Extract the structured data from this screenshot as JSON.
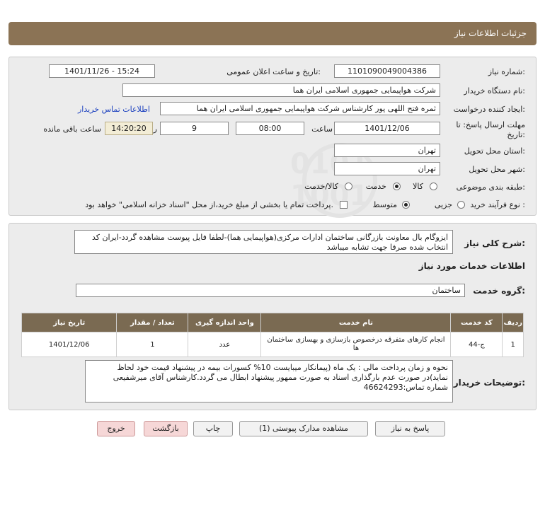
{
  "header": {
    "title": "جزئیات اطلاعات نیاز"
  },
  "form": {
    "need_number_label": "شماره نیاز:",
    "need_number": "1101090049004386",
    "announce_label": "تاریخ و ساعت اعلان عمومی:",
    "announce_value": "1401/11/26 - 15:24",
    "buyer_org_label": "نام دستگاه خریدار:",
    "buyer_org": "شرکت هواپیمایی جمهوری اسلامی ایران هما",
    "requester_label": "ایجاد کننده درخواست:",
    "requester": "ثمره فتح اللهی پور کارشناس شرکت هواپیمایی جمهوری اسلامی ایران هما",
    "contact_link": "اطلاعات تماس خریدار",
    "deadline_label_1": "مهلت ارسال پاسخ: تا",
    "deadline_label_2": "تاریخ:",
    "deadline_date": "1401/12/06",
    "time_label": "ساعت",
    "deadline_time": "08:00",
    "days_value": "9",
    "days_label": "روز و",
    "remaining_time": "14:20:20",
    "remaining_label": "ساعت باقی مانده",
    "province_label": "استان محل تحویل:",
    "province": "تهران",
    "city_label": "شهر محل تحویل:",
    "city": "تهران",
    "category_label": "طبقه بندی موضوعی:",
    "category_options": [
      "کالا",
      "خدمت",
      "کالا/خدمت"
    ],
    "category_selected": "خدمت",
    "process_label": "نوع فرآیند خرید :",
    "process_options": [
      "جزیی",
      "متوسط"
    ],
    "process_selected": "متوسط",
    "payment_note": "پرداخت تمام یا بخشی از مبلغ خرید،از محل \"اسناد خزانه اسلامی\" خواهد بود."
  },
  "description": {
    "label": "شرح کلی نیاز:",
    "text": "ایزوگام بال معاونت بازرگانی ساختمان ادارات مرکزی(هواپیمایی هما)-لطفا فایل پیوست مشاهده گردد-ایران کد انتخاب شده صرفا جهت تشابه میباشد"
  },
  "services": {
    "section_title": "اطلاعات خدمات مورد نیاز",
    "group_label": "گروه خدمت:",
    "group_value": "ساختمان",
    "columns": [
      "ردیف",
      "کد خدمت",
      "نام خدمت",
      "واحد اندازه گیری",
      "تعداد / مقدار",
      "تاریخ نیاز"
    ],
    "rows": [
      {
        "index": "1",
        "code": "ج-44",
        "name": "انجام کارهای متفرقه درخصوص بازسازی و بهسازی ساختمان ها",
        "unit": "عدد",
        "qty": "1",
        "date": "1401/12/06"
      }
    ]
  },
  "buyer_notes": {
    "label": "توضیحات خریدار:",
    "text": "نحوه و زمان پرداخت مالی : یک ماه (پیمانکار میبایست 10% کسورات بیمه در پیشنهاد قیمت خود لحاظ نماید)در صورت عدم بارگذاری اسناد به صورت ممهور پیشنهاد ابطال می گردد.کارشناس آقای میرشفیعی شماره تماس:46624293"
  },
  "buttons": {
    "reply": "پاسخ به نیاز",
    "attachments": "مشاهده مدارک پیوستی (1)",
    "print": "چاپ",
    "back": "بازگشت",
    "exit": "خروج"
  },
  "watermark": {
    "brand": "ParsNamadData"
  },
  "colors": {
    "header_bg": "#8b7355",
    "table_head_bg": "#7a6a52",
    "link": "#1a3fbf"
  }
}
